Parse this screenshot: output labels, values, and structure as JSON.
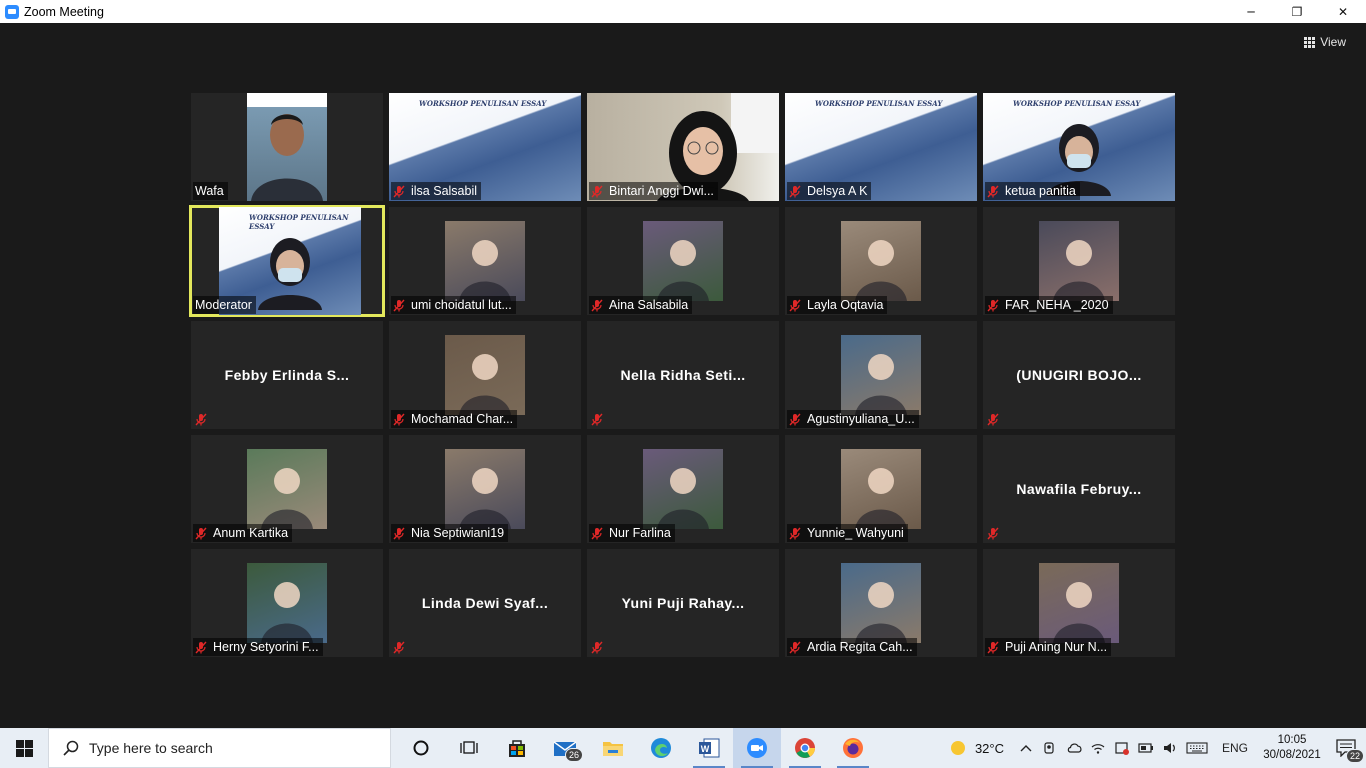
{
  "window": {
    "title": "Zoom Meeting",
    "minimize": "─",
    "restore": "❐",
    "close": "✕"
  },
  "meeting": {
    "view_label": "View",
    "tiles": [
      {
        "name": "Wafa",
        "muted": false,
        "kind": "photo",
        "active": false
      },
      {
        "name": "ilsa Salsabil",
        "muted": true,
        "kind": "banner",
        "active": false
      },
      {
        "name": "Bintari Anggi Dwi...",
        "muted": true,
        "kind": "photo-full",
        "active": false
      },
      {
        "name": "Delsya A K",
        "muted": true,
        "kind": "banner",
        "active": false
      },
      {
        "name": "ketua panitia",
        "muted": true,
        "kind": "banner-person",
        "active": false
      },
      {
        "name": "Moderator",
        "muted": false,
        "kind": "banner-person",
        "active": true
      },
      {
        "name": "umi choidatul lut...",
        "muted": true,
        "kind": "avatar",
        "active": false
      },
      {
        "name": "Aina Salsabila",
        "muted": true,
        "kind": "avatar",
        "active": false
      },
      {
        "name": "Layla Oqtavia",
        "muted": true,
        "kind": "avatar",
        "active": false
      },
      {
        "name": "FAR_NEHA _2020",
        "muted": true,
        "kind": "avatar",
        "active": false
      },
      {
        "name": "",
        "display": "Febby  Erlinda  S...",
        "muted": true,
        "kind": "text",
        "active": false
      },
      {
        "name": "Mochamad Char...",
        "muted": true,
        "kind": "avatar",
        "active": false
      },
      {
        "name": "",
        "display": "Nella  Ridha  Seti...",
        "muted": true,
        "kind": "text",
        "active": false
      },
      {
        "name": "Agustinyuliana_U...",
        "muted": true,
        "kind": "avatar",
        "active": false
      },
      {
        "name": "",
        "display": "(UNUGIRI  BOJO...",
        "muted": true,
        "kind": "text",
        "active": false
      },
      {
        "name": "Anum Kartika",
        "muted": true,
        "kind": "avatar",
        "active": false
      },
      {
        "name": "Nia Septiwiani19",
        "muted": true,
        "kind": "avatar",
        "active": false
      },
      {
        "name": "Nur Farlina",
        "muted": true,
        "kind": "avatar",
        "active": false
      },
      {
        "name": "Yunnie_ Wahyuni",
        "muted": true,
        "kind": "avatar",
        "active": false
      },
      {
        "name": "",
        "display": "Nawafila  Februy...",
        "muted": true,
        "kind": "text",
        "active": false
      },
      {
        "name": "Herny Setyorini F...",
        "muted": true,
        "kind": "avatar",
        "active": false
      },
      {
        "name": "",
        "display": "Linda  Dewi  Syaf...",
        "muted": true,
        "kind": "text",
        "active": false
      },
      {
        "name": "",
        "display": "Yuni  Puji  Rahay...",
        "muted": true,
        "kind": "text",
        "active": false
      },
      {
        "name": "Ardia Regita Cah...",
        "muted": true,
        "kind": "avatar",
        "active": false
      },
      {
        "name": "Puji Aning Nur N...",
        "muted": true,
        "kind": "avatar",
        "active": false
      }
    ],
    "banner_title": "WORKSHOP PENULISAN ESSAY"
  },
  "taskbar": {
    "search_placeholder": "Type here to search",
    "mail_badge": "26",
    "weather": "32°C",
    "language": "ENG",
    "time": "10:05",
    "date": "30/08/2021",
    "notifications": "22"
  },
  "colors": {
    "active_speaker": "#e3e85c",
    "muted": "#e02828",
    "taskbar": "#e8eef5"
  }
}
